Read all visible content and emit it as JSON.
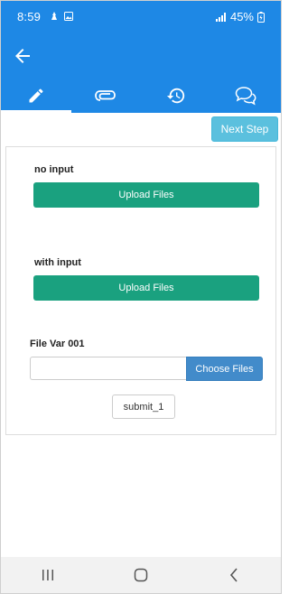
{
  "status_bar": {
    "time": "8:59",
    "battery": "45%",
    "left_icons": [
      "notification-icon",
      "image-icon"
    ],
    "right_icons": [
      "signal-icon",
      "battery-charging-icon"
    ]
  },
  "app_bar": {
    "back_icon": "arrow-left-icon"
  },
  "tabs": [
    {
      "icon": "pencil-icon",
      "active": true
    },
    {
      "icon": "paperclip-icon",
      "active": false
    },
    {
      "icon": "history-icon",
      "active": false
    },
    {
      "icon": "chat-bubbles-icon",
      "active": false
    }
  ],
  "toolbar": {
    "next_step_label": "Next Step"
  },
  "form": {
    "no_input_label": "no input",
    "upload_files_label_1": "Upload Files",
    "with_input_label": "with input",
    "upload_files_label_2": "Upload Files",
    "file_var_label": "File Var 001",
    "file_input_value": "",
    "choose_files_label": "Choose Files",
    "submit_label": "submit_1"
  },
  "colors": {
    "primary": "#1e88e5",
    "upload_button": "#1aa17f",
    "next_step_button": "#5bc0de",
    "choose_files_button": "#428bca"
  },
  "nav_bar": {
    "buttons": [
      "recent-apps-icon",
      "home-icon",
      "back-icon"
    ]
  }
}
